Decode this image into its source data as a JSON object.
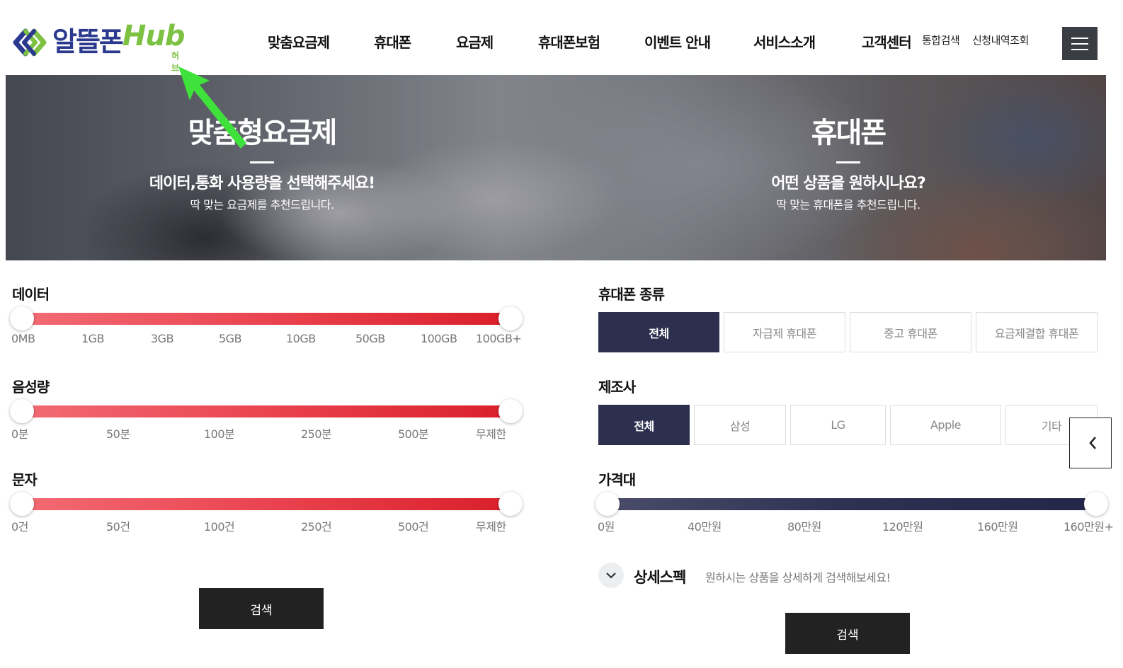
{
  "brand": {
    "name_ko": "알뜰폰",
    "name_hub": "Hub",
    "name_sub": "허브",
    "colors": {
      "primary": "#2b3a8f",
      "accent": "#7cc142"
    }
  },
  "nav": {
    "items": [
      "맞춤요금제",
      "휴대폰",
      "요금제",
      "휴대폰보험",
      "이벤트 안내",
      "서비스소개",
      "고객센터"
    ],
    "utility": [
      "통합검색",
      "신청내역조회"
    ],
    "menu_icon": "hamburger-icon"
  },
  "hero": {
    "left": {
      "title": "맞춤형요금제",
      "subtitle": "데이터,통화 사용량을 선택해주세요!",
      "description": "딱 맞는 요금제를 추천드립니다."
    },
    "right": {
      "title": "휴대폰",
      "subtitle": "어떤 상품을 원하시나요?",
      "description": "딱 맞는 휴대폰을 추천드립니다."
    }
  },
  "plan_filter": {
    "data": {
      "label": "데이터",
      "ticks": [
        "0MB",
        "1GB",
        "3GB",
        "5GB",
        "10GB",
        "50GB",
        "100GB",
        "100GB+"
      ],
      "range": [
        "0MB",
        "100GB+"
      ]
    },
    "voice": {
      "label": "음성량",
      "ticks": [
        "0분",
        "50분",
        "100분",
        "250분",
        "500분",
        "무제한"
      ],
      "range": [
        "0분",
        "무제한"
      ]
    },
    "sms": {
      "label": "문자",
      "ticks": [
        "0건",
        "50건",
        "100건",
        "250건",
        "500건",
        "무제한"
      ],
      "range": [
        "0건",
        "무제한"
      ]
    },
    "search_label": "검색"
  },
  "phone_filter": {
    "type": {
      "label": "휴대폰 종류",
      "options": [
        "전체",
        "자급제 휴대폰",
        "중고 휴대폰",
        "요금제결합 휴대폰"
      ],
      "selected": "전체"
    },
    "maker": {
      "label": "제조사",
      "options": [
        "전체",
        "삼성",
        "LG",
        "Apple",
        "기타"
      ],
      "selected": "전체"
    },
    "price": {
      "label": "가격대",
      "ticks": [
        "0원",
        "40만원",
        "80만원",
        "120만원",
        "160만원",
        "160만원+"
      ],
      "range": [
        "0원",
        "160만원+"
      ]
    },
    "detail_spec": {
      "title": "상세스펙",
      "description": "원하시는 상품을 상세하게 검색해보세요!"
    },
    "search_label": "검색"
  },
  "colors": {
    "slider_red": "#e2333e",
    "slider_navy": "#2c2f4d",
    "selected_option": "#2c2f4d",
    "button_dark": "#222222",
    "cursor_arrow": "#3ee23a"
  }
}
